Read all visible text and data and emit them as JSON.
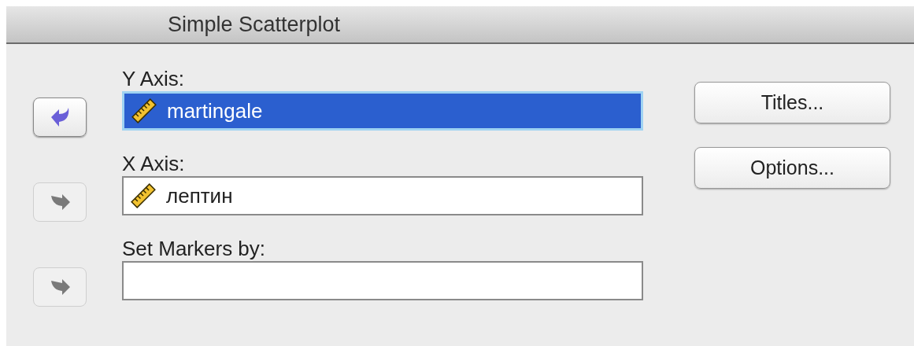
{
  "window": {
    "title": "Simple Scatterplot"
  },
  "targets": [
    {
      "label": "Y Axis:",
      "kind": "remove",
      "disabled": false,
      "selected": true,
      "variable": "martingale"
    },
    {
      "label": "X Axis:",
      "kind": "add",
      "disabled": true,
      "selected": false,
      "variable": "лептин"
    },
    {
      "label": "Set Markers by:",
      "kind": "add",
      "disabled": true,
      "selected": false
    }
  ],
  "buttons": [
    "Titles...",
    "Options..."
  ]
}
